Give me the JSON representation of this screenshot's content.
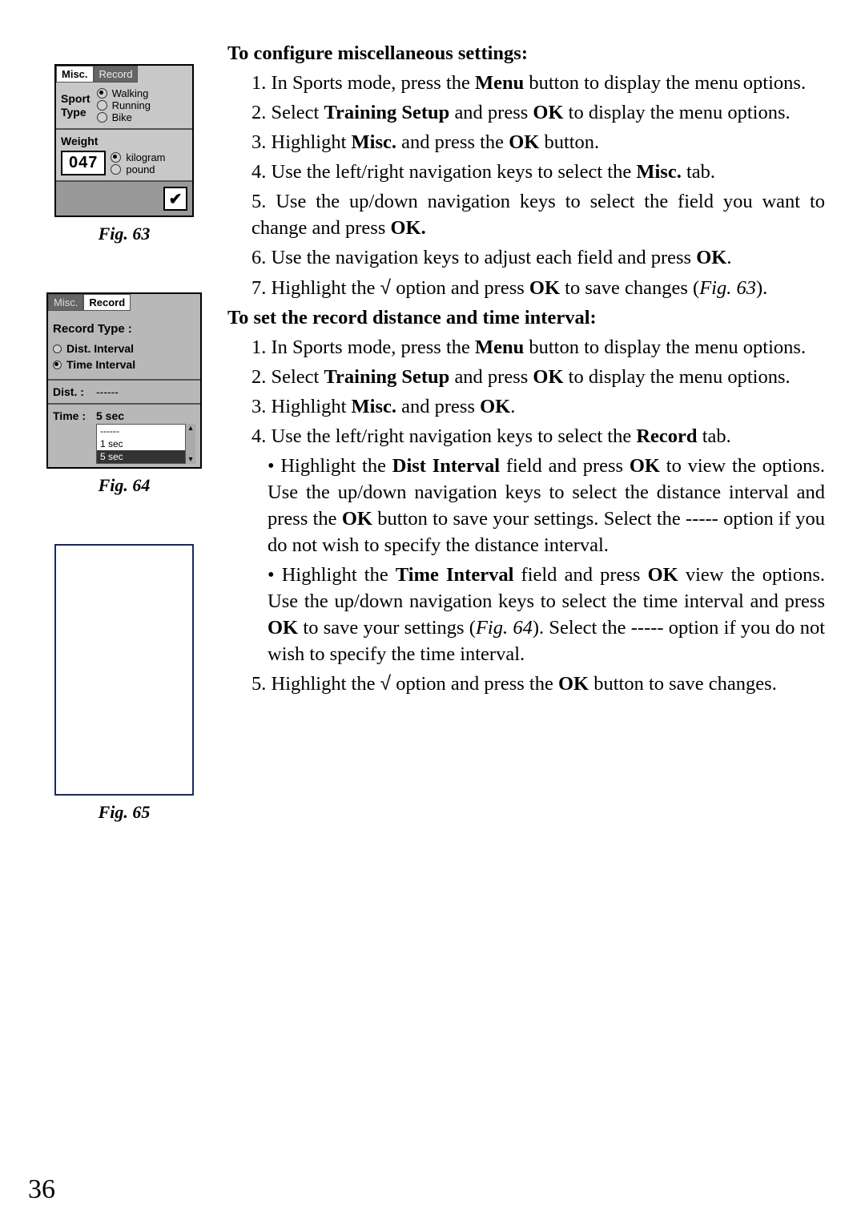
{
  "page_number": "36",
  "headings": {
    "h1": "To configure miscellaneous settings:",
    "h2": "To set the record distance and time interval:"
  },
  "section1": {
    "s1a": "1. In Sports mode, press the ",
    "s1b": "Menu",
    "s1c": " button to display the menu options.",
    "s2a": "2.  Select ",
    "s2b": "Training Setup",
    "s2c": " and press ",
    "s2d": "OK",
    "s2e": " to display the menu options.",
    "s3a": "3. Highlight ",
    "s3b": "Misc.",
    "s3c": " and press the ",
    "s3d": "OK",
    "s3e": " button.",
    "s4a": "4. Use the left/right navigation keys to select the ",
    "s4b": "Misc.",
    "s4c": " tab.",
    "s5a": "5. Use the up/down navigation keys to select the field you want to change and press ",
    "s5b": "OK.",
    "s6a": "6. Use the navigation keys to adjust each field and press ",
    "s6b": "OK",
    "s6c": ".",
    "s7a": "7. Highlight the ",
    "s7b": "√",
    "s7c": " option and press ",
    "s7d": "OK",
    "s7e": " to save changes (",
    "s7f": "Fig. 63",
    "s7g": ")."
  },
  "section2": {
    "s1a": "1. In Sports mode, press the ",
    "s1b": "Menu",
    "s1c": " button to display the menu options.",
    "s2a": "2. Select ",
    "s2b": "Training Setup",
    "s2c": " and press ",
    "s2d": "OK",
    "s2e": " to display the menu options.",
    "s3a": "3. Highlight ",
    "s3b": "Misc.",
    "s3c": " and press ",
    "s3d": "OK",
    "s3e": ".",
    "s4a": "4. Use the left/right navigation keys to select the ",
    "s4b": "Record",
    "s4c": " tab.",
    "b1a": "• Highlight the ",
    "b1b": "Dist Interval",
    "b1c": " field and press ",
    "b1d": "OK",
    "b1e": " to view the options. Use the up/down navigation keys to select the distance interval and press the ",
    "b1f": "OK",
    "b1g": " button to save your settings. Select the ----- option if you do not wish to specify the distance interval.",
    "b2a": "• Highlight the ",
    "b2b": "Time Interval",
    "b2c": " field and press ",
    "b2d": "OK",
    "b2e": " view the options. Use the up/down navigation keys to select the time interval and press ",
    "b2f": "OK",
    "b2g": " to save your settings (",
    "b2h": "Fig. 64",
    "b2i": "). Select the ----- option if you do not wish to specify the time interval.",
    "s5a": "5. Highlight the ",
    "s5b": "√",
    "s5c": " option and press the ",
    "s5d": "OK",
    "s5e": " button to save changes."
  },
  "captions": {
    "fig63": "Fig. 63",
    "fig64": "Fig. 64",
    "fig65": "Fig. 65"
  },
  "device1": {
    "tab_misc": "Misc.",
    "tab_record": "Record",
    "sport_type_label1": "Sport",
    "sport_type_label2": "Type",
    "opt_walking": "Walking",
    "opt_running": "Running",
    "opt_bike": "Bike",
    "weight_label": "Weight",
    "weight_value": "047",
    "unit_kilogram": "kilogram",
    "unit_pound": "pound",
    "check": "✔"
  },
  "device2": {
    "tab_misc": "Misc.",
    "tab_record": "Record",
    "record_type": "Record Type :",
    "dist_interval": "Dist. Interval",
    "time_interval": "Time Interval",
    "dist_label": "Dist. :",
    "time_label": "Time :",
    "dist_value": "------",
    "time_value": "5 sec",
    "dd_dash": "------",
    "dd_1sec": "1 sec",
    "dd_5sec": "5 sec",
    "arrow_up": "▴",
    "arrow_dn": "▾"
  }
}
